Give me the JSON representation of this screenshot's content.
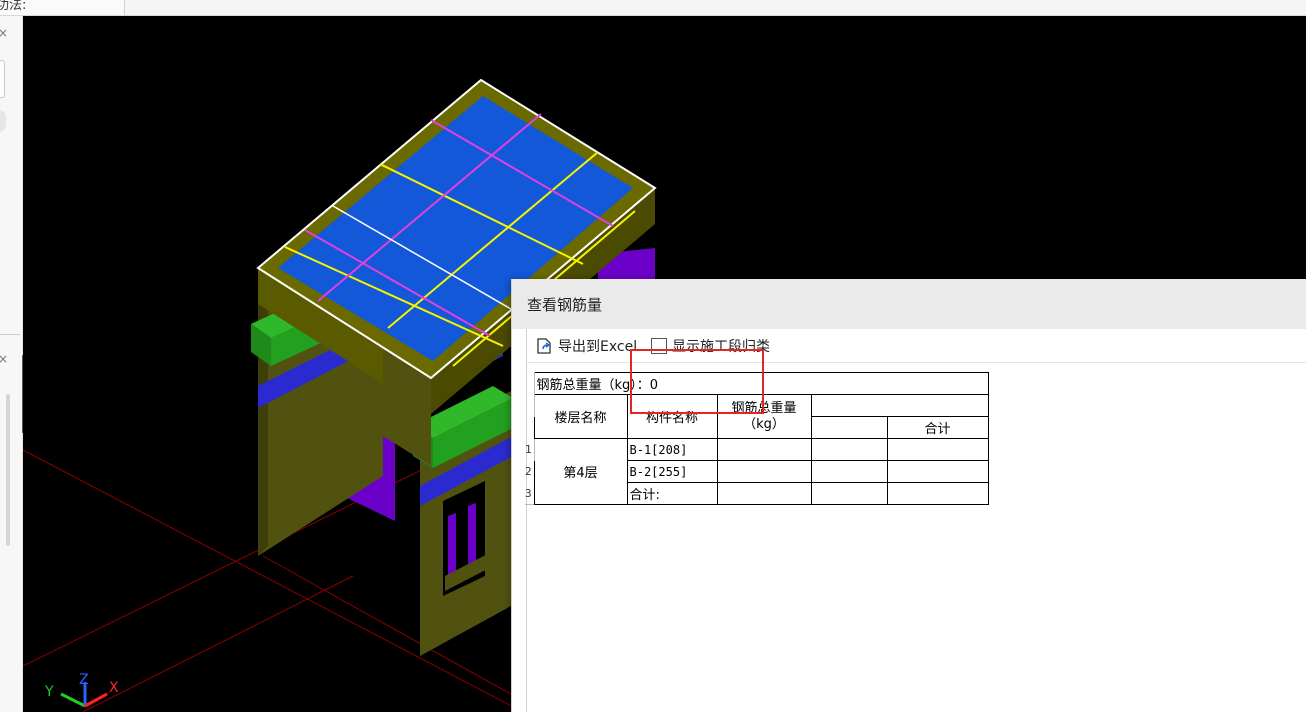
{
  "window": {
    "partial_tab_label": "功法:"
  },
  "left_strip": {
    "close_1": "×",
    "close_2": "×",
    "collapse_arrow": "‹"
  },
  "viewport": {
    "axis_labels": {
      "y": "Y",
      "z": "Z",
      "x": "X"
    },
    "colors": {
      "slab": "#1258d8",
      "beam": "#5a5a00",
      "column": "#6b00c8",
      "wall": "#525210",
      "ledge": "#22a020",
      "band": "#2a2ad0",
      "rebar_yellow": "#f5f500",
      "rebar_magenta": "#e040e0",
      "grid_line": "#8b0000"
    }
  },
  "dialog": {
    "title": "查看钢筋量",
    "toolbar": {
      "export_label": "导出到Excel",
      "export_icon": "export-icon",
      "show_stage_label": "显示施工段归类",
      "show_stage_checked": false
    },
    "table": {
      "total_label": "钢筋总重量（kg）：0",
      "headers": {
        "floor": "楼层名称",
        "member": "构件名称",
        "weight_line1": "钢筋总重量",
        "weight_line2": "（kg）",
        "subtotal": "合计"
      },
      "row_numbers": [
        "1",
        "2",
        "3"
      ],
      "floor_value": "第4层",
      "rows": [
        {
          "member": "B-1[208]"
        },
        {
          "member": "B-2[255]"
        },
        {
          "member": "合计:"
        }
      ]
    }
  }
}
